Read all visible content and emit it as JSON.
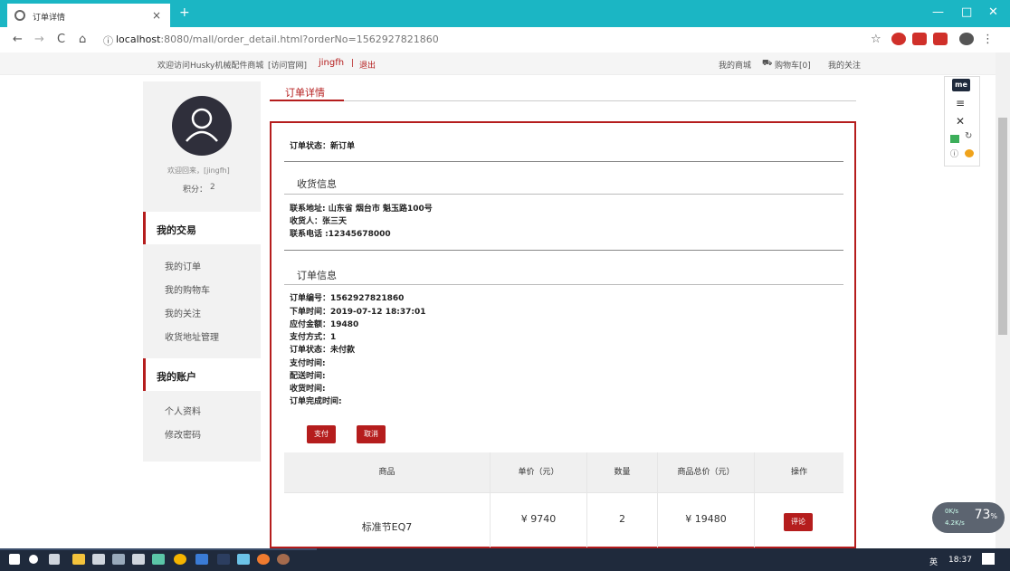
{
  "browser": {
    "tab_title": "订单详情",
    "tab_close": "×",
    "new_tab": "+",
    "url_host": "localhost",
    "url_rest": ":8080/mall/order_detail.html?orderNo=1562927821860",
    "nav_back": "←",
    "nav_forward": "→",
    "nav_reload": "C",
    "nav_home": "⌂",
    "info_icon": "ⓘ",
    "star": "☆",
    "menu": "⋮",
    "win_min": "—",
    "win_max": "□",
    "win_close": "✕"
  },
  "topnav": {
    "welcome": "欢迎访问Husky机械配件商城",
    "official": "[访问官网]",
    "username": "jingfh",
    "separator": "|",
    "logout": "退出",
    "my_mall": "我的商城",
    "cart": "购物车[0]",
    "my_follow": "我的关注"
  },
  "sidebar": {
    "welcome": "欢迎回来，[jingfh]",
    "points_label": "积分：",
    "points_value": "2",
    "trade_title": "我的交易",
    "trade_links": [
      "我的订单",
      "我的购物车",
      "我的关注",
      "收货地址管理"
    ],
    "account_title": "我的账户",
    "account_links": [
      "个人资料",
      "修改密码"
    ]
  },
  "main": {
    "tab_title": "订单详情",
    "order_status_line": "订单状态：新订单",
    "shipping_title": "收货信息",
    "contact_address": "联系地址: 山东省 烟台市 魁玉路100号",
    "receiver": "收货人：张三天",
    "phone": "联系电话 :12345678000",
    "order_info_title": "订单信息",
    "order_no": "订单编号：1562927821860",
    "order_time": "下单时间：2019-07-12 18:37:01",
    "amount": "应付金额：19480",
    "pay_method": "支付方式：1",
    "status": "订单状态：未付款",
    "pay_time": "支付时间:",
    "ship_time": "配送时间:",
    "receive_time": "收货时间:",
    "finish_time": "订单完成时间:",
    "pay_button": "支付",
    "cancel_button": "取消"
  },
  "table": {
    "headers": [
      "商品",
      "单价（元）",
      "数量",
      "商品总价（元）",
      "操作"
    ],
    "rows": [
      {
        "product": "标准节EQ7",
        "price": "¥ 9740",
        "qty": "2",
        "total": "¥ 19480",
        "action": "评论"
      }
    ]
  },
  "widget": {
    "speed_pct": "73",
    "speed_suffix": "%",
    "up": "0K/s",
    "down": "4.2K/s"
  },
  "taskbar": {
    "time": "18:37",
    "ime": "英"
  },
  "colors": {
    "accent": "#b51d1d",
    "titlebar": "#1bb6c4",
    "taskbar": "#1f2a3c"
  }
}
